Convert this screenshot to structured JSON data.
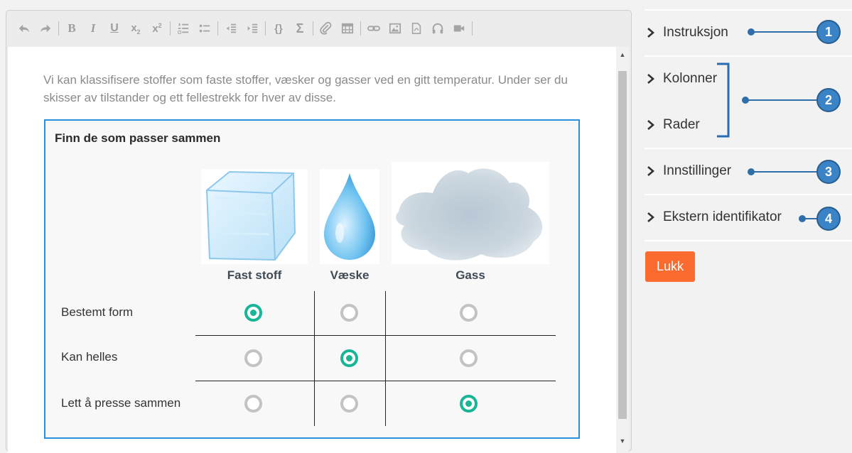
{
  "editor": {
    "toolbar": [
      "undo-icon",
      "redo-icon",
      "sep",
      "bold-icon",
      "italic-icon",
      "underline-icon",
      "subscript-icon",
      "superscript-icon",
      "sep",
      "numbered-list-icon",
      "bullet-list-icon",
      "sep",
      "outdent-icon",
      "indent-icon",
      "sep",
      "code-icon",
      "sigma-icon",
      "sep",
      "attach-icon",
      "table-icon",
      "sep",
      "link-icon",
      "image-icon",
      "pdf-icon",
      "audio-icon",
      "video-icon",
      "sep"
    ],
    "intro": "Vi kan klassifisere stoffer som faste stoffer, væsker og gasser ved en gitt temperatur. Under ser du skisser av tilstander og ett fellestrekk for hver av disse."
  },
  "task": {
    "title": "Finn de som passer sammen",
    "columns": [
      "Fast stoff",
      "Væske",
      "Gass"
    ],
    "rows": [
      {
        "label": "Bestemt form",
        "selected": 0
      },
      {
        "label": "Kan helles",
        "selected": 1
      },
      {
        "label": "Lett å presse sammen",
        "selected": 2
      }
    ]
  },
  "panel": {
    "items": [
      {
        "label": "Instruksjon",
        "callout": "1"
      },
      {
        "label": "Kolonner",
        "callout": "2"
      },
      {
        "label": "Rader",
        "callout": "2"
      },
      {
        "label": "Innstillinger",
        "callout": "3"
      },
      {
        "label": "Ekstern identifikator",
        "callout": "4"
      }
    ],
    "close_label": "Lukk",
    "accent": "#3a83c6",
    "button_color": "#fb6a2e"
  }
}
